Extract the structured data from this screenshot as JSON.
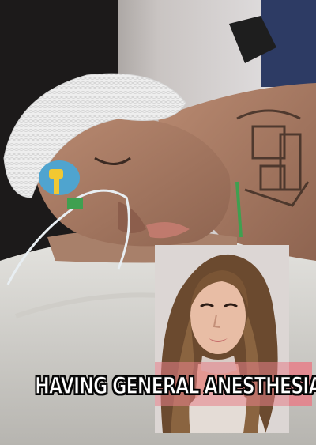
{
  "caption": {
    "text": "HAVING GENERAL ANESTHESIA"
  },
  "colors": {
    "caption_text": "#ffffff",
    "caption_stroke": "#111111",
    "caption_band": "#e67f88"
  },
  "inset": {
    "description_icon": "person-speaking-icon"
  }
}
